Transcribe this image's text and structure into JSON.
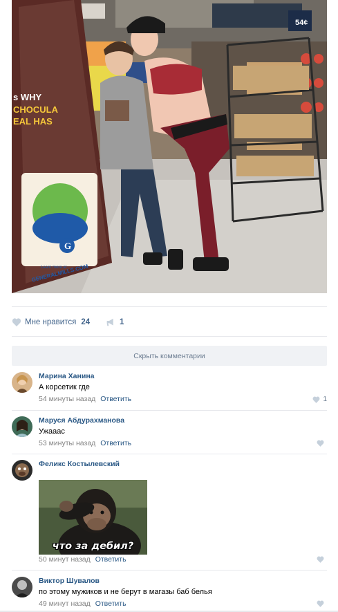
{
  "post": {
    "likes_label": "Мне нравится",
    "likes_count": "24",
    "shares_count": "1",
    "photo_sign": {
      "line1": "s WHY",
      "line2": "CHOCULA",
      "line3": "EAL HAS",
      "logo": "G",
      "url_line1": "Learn more at",
      "url_line2": "GENERALMILLS.COM",
      "price": "54¢"
    }
  },
  "comments_toggle": {
    "label": "Скрыть комментарии"
  },
  "comments": [
    {
      "author": "Марина Ханина",
      "text": "А корсетик где",
      "time": "54 минуты назад",
      "reply": "Ответить",
      "likes": "1"
    },
    {
      "author": "Маруся Абдурахманова",
      "text": "Ужааас",
      "time": "53 минуты назад",
      "reply": "Ответить",
      "likes": ""
    },
    {
      "author": "Феликс Костылевский",
      "image_caption": "что за дебил?",
      "time": "50 минут назад",
      "reply": "Ответить",
      "likes": ""
    },
    {
      "author": "Виктор Шувалов",
      "text": "по этому мужиков и не берут в магазы баб белья",
      "time": "49 минут назад",
      "reply": "Ответить",
      "likes": ""
    }
  ],
  "colors": {
    "link": "#2a5885",
    "action": "#42648b",
    "meta": "#828282",
    "divider": "#e7e8ec",
    "toggle_bg": "#f0f2f5"
  }
}
